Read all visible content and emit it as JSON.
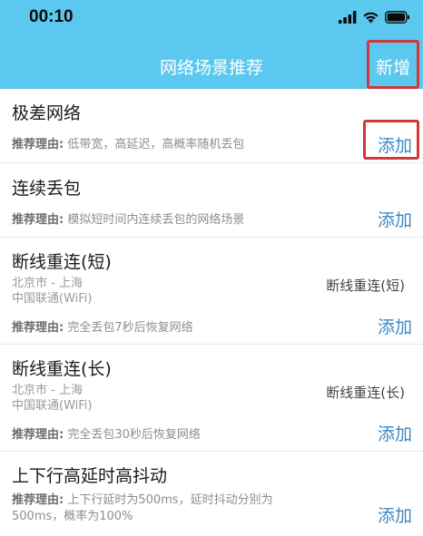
{
  "status_bar": {
    "time": "00:10"
  },
  "nav": {
    "title": "网络场景推荐",
    "add_label": "新增"
  },
  "reason_label": "推荐理由:",
  "items": [
    {
      "title": "极差网络",
      "reason": " 低带宽，高延迟，高概率随机丢包",
      "add": "添加"
    },
    {
      "title": "连续丢包",
      "reason": " 模拟短时间内连续丢包的网络场景",
      "add": "添加"
    },
    {
      "title": "断线重连(短)",
      "location": "北京市 - 上海",
      "carrier": "中国联通(WiFi)",
      "side": "断线重连(短)",
      "reason": " 完全丢包7秒后恢复网络",
      "add": "添加"
    },
    {
      "title": "断线重连(长)",
      "location": "北京市 - 上海",
      "carrier": "中国联通(WiFi)",
      "side": "断线重连(长)",
      "reason": " 完全丢包30秒后恢复网络",
      "add": "添加"
    },
    {
      "title": "上下行高延时高抖动",
      "reason": " 上下行延时为500ms，延时抖动分别为",
      "reason2": "500ms，概率为100%",
      "add": "添加"
    }
  ],
  "colors": {
    "header": "#5bc8ef",
    "accent": "#3b88c4",
    "highlight": "#d2373a"
  }
}
